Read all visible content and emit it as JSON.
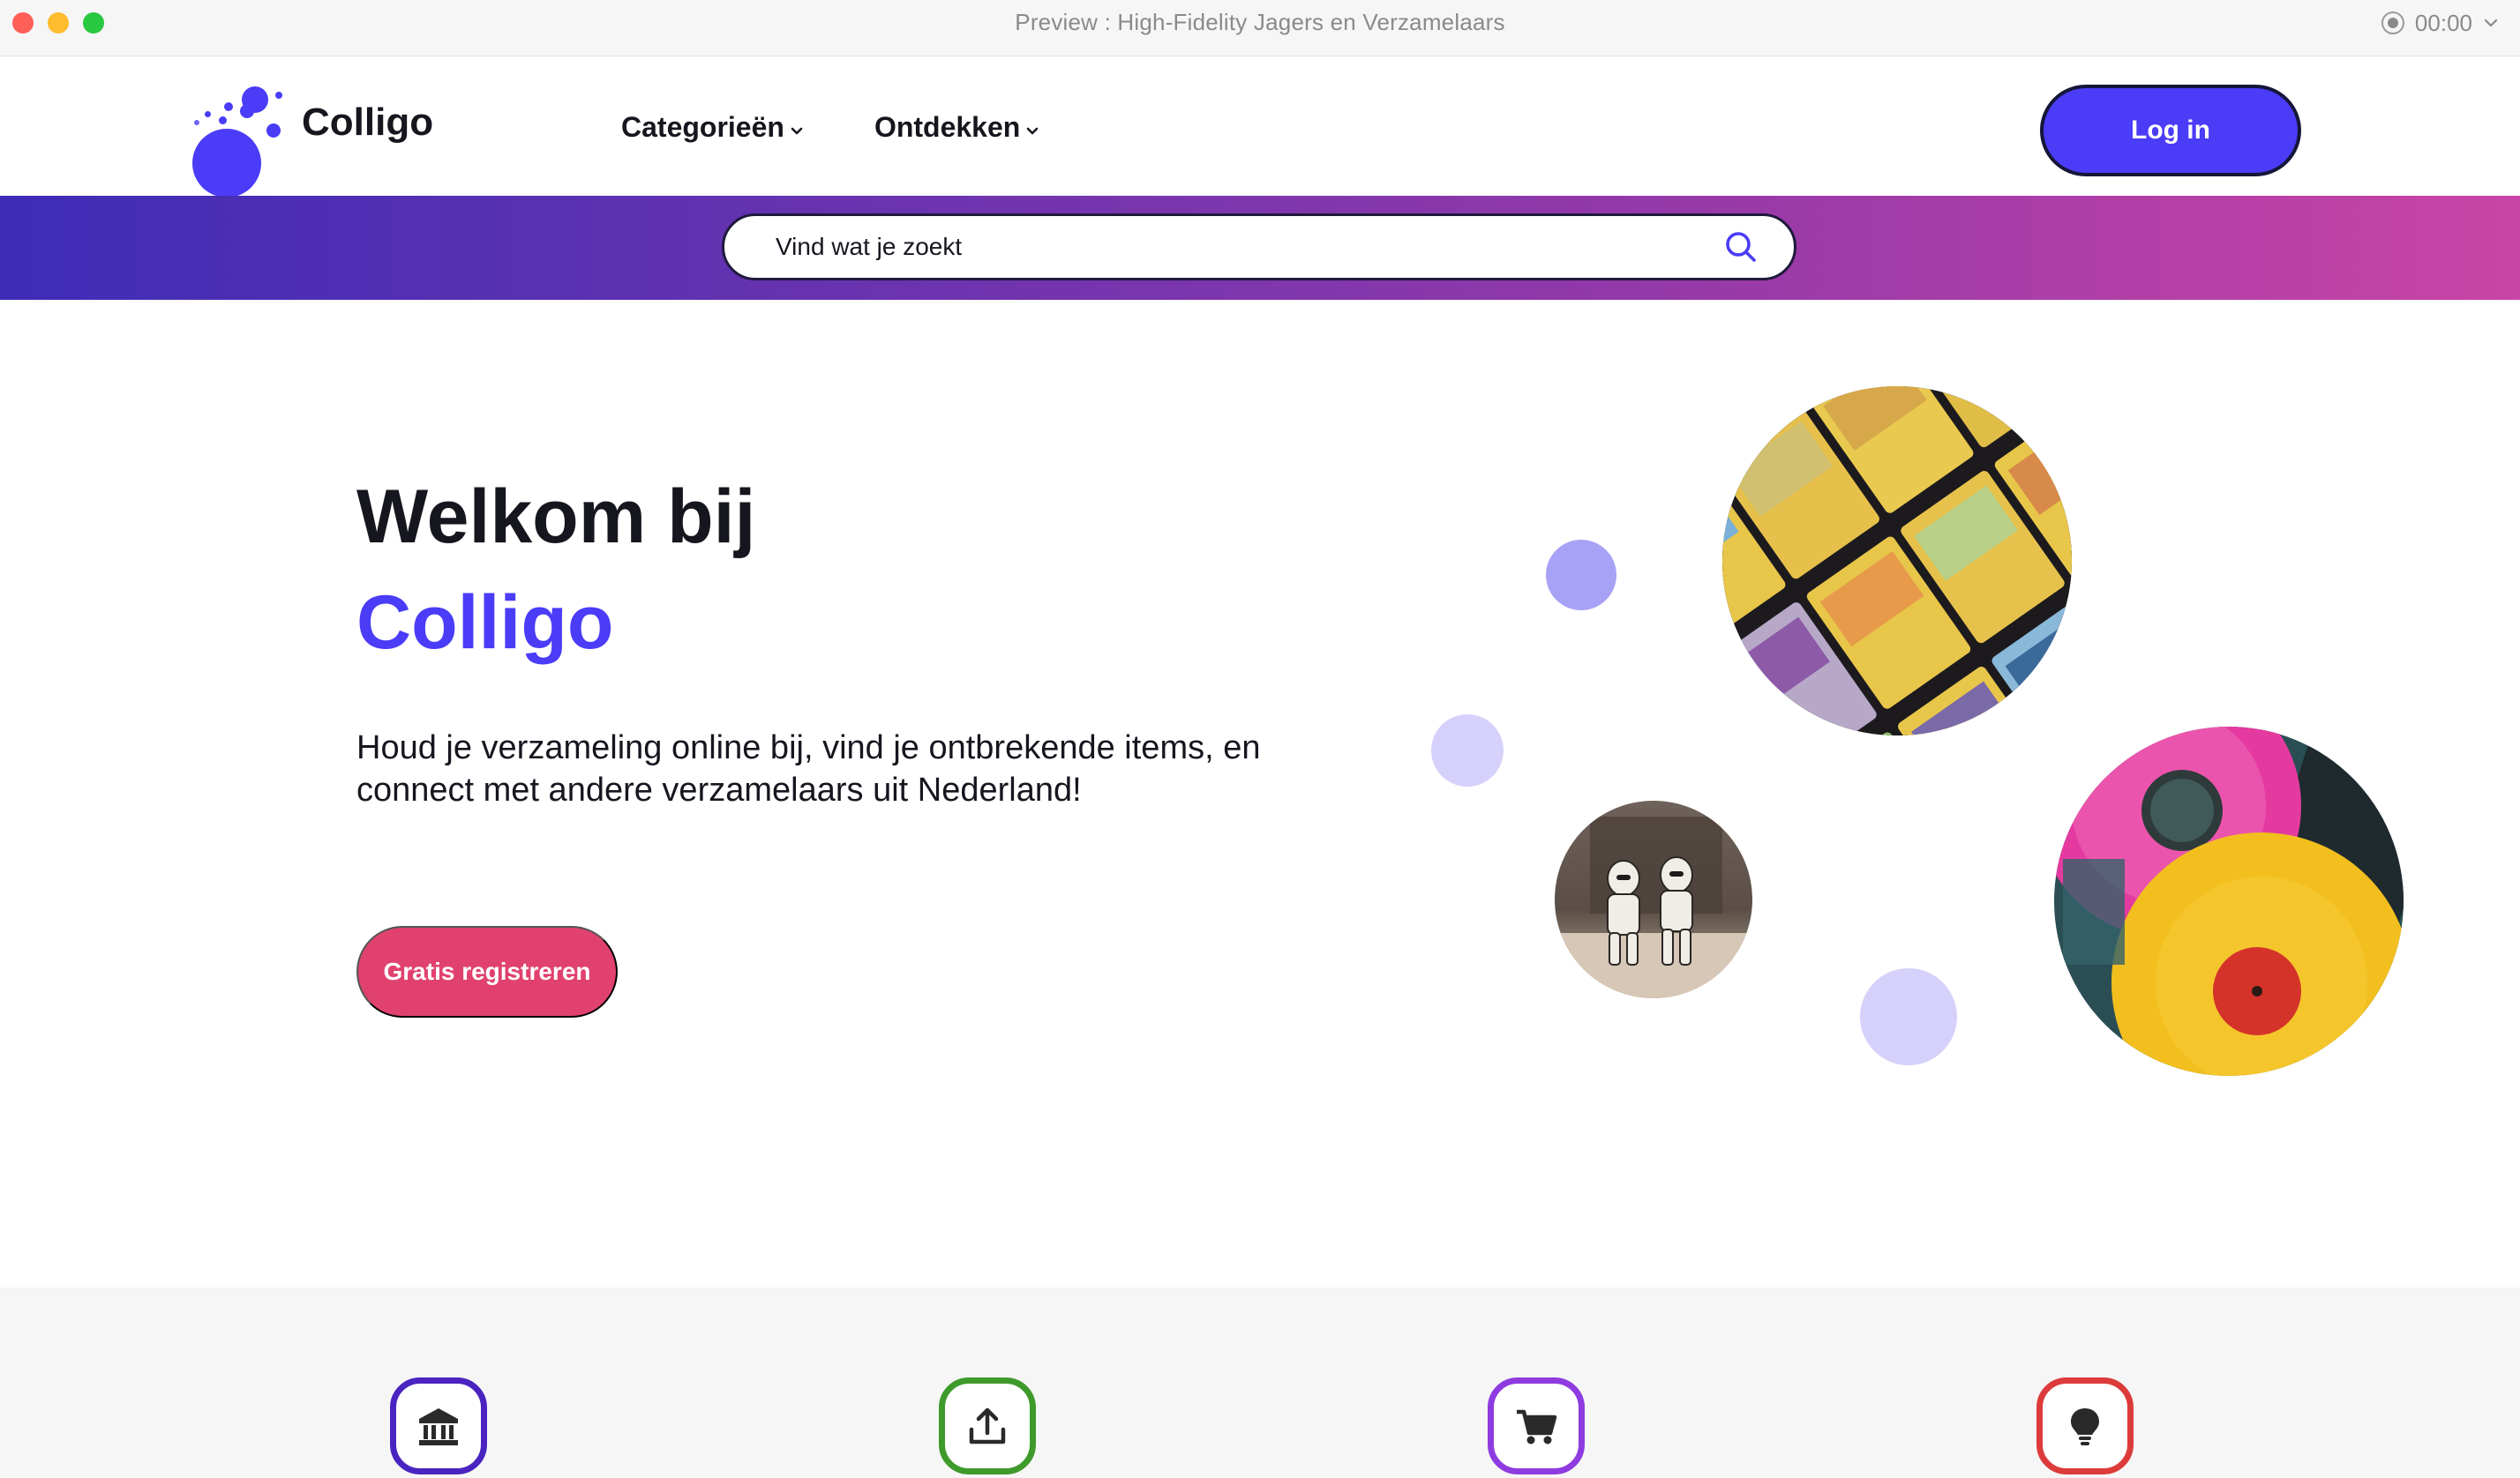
{
  "window": {
    "title": "Preview : High-Fidelity Jagers en Verzamelaars",
    "timer": "00:00"
  },
  "header": {
    "logo_text": "Colligo",
    "nav": [
      {
        "label": "Categorieën",
        "icon": "chevron-down-icon"
      },
      {
        "label": "Ontdekken",
        "icon": "chevron-down-icon"
      }
    ],
    "login_label": "Log in"
  },
  "search": {
    "placeholder": "Vind wat je zoekt",
    "icon": "search-icon"
  },
  "hero": {
    "title_line1": "Welkom bij",
    "title_line2": "Colligo",
    "subtitle": "Houd je verzameling online bij, vind je ontbrekende items, en connect met andere verzamelaars uit Nederland!",
    "register_label": "Gratis registreren",
    "photos": [
      "trading-cards-photo",
      "stormtrooper-figures-photo",
      "vinyl-records-photo"
    ]
  },
  "features": [
    {
      "icon": "museum-icon",
      "color": "#4a24c0"
    },
    {
      "icon": "upload-icon",
      "color": "#3f9a2c"
    },
    {
      "icon": "cart-icon",
      "color": "#8e3be0"
    },
    {
      "icon": "lightbulb-icon",
      "color": "#dd3b3b"
    }
  ],
  "colors": {
    "brand": "#4a3cf7",
    "cta": "#e0416e",
    "gradient_start": "#3e2cb6",
    "gradient_end": "#c944a6"
  }
}
